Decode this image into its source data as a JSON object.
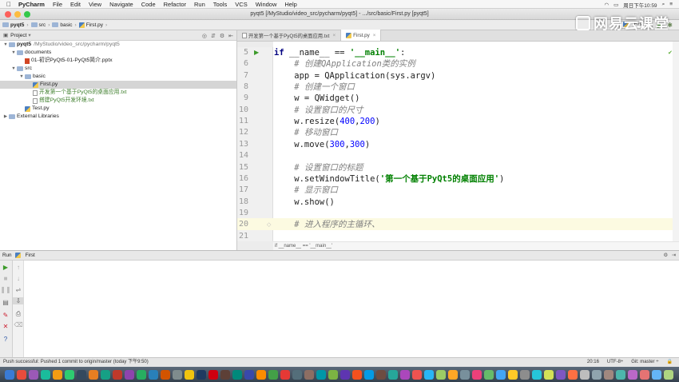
{
  "menubar": {
    "app": "PyCharm",
    "items": [
      "File",
      "Edit",
      "View",
      "Navigate",
      "Code",
      "Refactor",
      "Run",
      "Tools",
      "VCS",
      "Window",
      "Help"
    ],
    "clock": "周日下午10:59"
  },
  "window": {
    "title": "pyqt5 [/MyStudio/video_src/pycharm/pyqt5] - .../src/basic/First.py [pyqt5]"
  },
  "breadcrumbs": [
    "pyqt5",
    "src",
    "basic",
    "First.py"
  ],
  "run_config": "First",
  "watermark": "网易云课堂",
  "project": {
    "header": "Project",
    "tree": [
      {
        "label": "pyqt5",
        "extra": "/MyStudio/video_src/pycharm/pyqt5",
        "depth": 0,
        "arrow": "▼",
        "icon": "folder",
        "style": "bold"
      },
      {
        "label": "documents",
        "extra": "",
        "depth": 1,
        "arrow": "▼",
        "icon": "folder",
        "style": ""
      },
      {
        "label": "01-初识PyQt5-01-PyQt5简介.pptx",
        "extra": "",
        "depth": 2,
        "arrow": "",
        "icon": "ppt",
        "style": ""
      },
      {
        "label": "src",
        "extra": "",
        "depth": 1,
        "arrow": "▼",
        "icon": "folder",
        "style": ""
      },
      {
        "label": "basic",
        "extra": "",
        "depth": 2,
        "arrow": "▼",
        "icon": "folder",
        "style": ""
      },
      {
        "label": "First.py",
        "extra": "",
        "depth": 3,
        "arrow": "",
        "icon": "py",
        "style": "sel"
      },
      {
        "label": "开发第一个基于PyQt5的桌面应用.txt",
        "extra": "",
        "depth": 3,
        "arrow": "",
        "icon": "txt",
        "style": "green"
      },
      {
        "label": "搭建PyQt5开发环境.txt",
        "extra": "",
        "depth": 3,
        "arrow": "",
        "icon": "txt",
        "style": "green"
      },
      {
        "label": "Test.py",
        "extra": "",
        "depth": 2,
        "arrow": "",
        "icon": "py",
        "style": ""
      },
      {
        "label": "External Libraries",
        "extra": "",
        "depth": 0,
        "arrow": "▶",
        "icon": "lib",
        "style": ""
      }
    ]
  },
  "tabs": [
    {
      "label": "开发第一个基于PyQt5的桌面应用.txt",
      "active": false
    },
    {
      "label": "First.py",
      "active": true
    }
  ],
  "editor": {
    "lines": [
      {
        "n": "5",
        "html": [
          [
            "kw",
            "if "
          ],
          [
            "",
            "__name__ == "
          ],
          [
            "str",
            "'__main__'"
          ],
          [
            "",
            ":"
          ]
        ]
      },
      {
        "n": "6",
        "html": [
          [
            "",
            "    "
          ],
          [
            "cm",
            "# 创建QApplication类的实例"
          ]
        ]
      },
      {
        "n": "7",
        "html": [
          [
            "",
            "    app = QApplication(sys.argv)"
          ]
        ]
      },
      {
        "n": "8",
        "html": [
          [
            "",
            "    "
          ],
          [
            "cm",
            "# 创建一个窗口"
          ]
        ]
      },
      {
        "n": "9",
        "html": [
          [
            "",
            "    w = QWidget()"
          ]
        ]
      },
      {
        "n": "10",
        "html": [
          [
            "",
            "    "
          ],
          [
            "cm",
            "# 设置窗口的尺寸"
          ]
        ]
      },
      {
        "n": "11",
        "html": [
          [
            "",
            "    w.resize("
          ],
          [
            "num",
            "400"
          ],
          [
            "",
            ","
          ],
          [
            "num",
            "200"
          ],
          [
            "",
            ")"
          ]
        ]
      },
      {
        "n": "12",
        "html": [
          [
            "",
            "    "
          ],
          [
            "cm",
            "# 移动窗口"
          ]
        ]
      },
      {
        "n": "13",
        "html": [
          [
            "",
            "    w.move("
          ],
          [
            "num",
            "300"
          ],
          [
            "",
            ","
          ],
          [
            "num",
            "300"
          ],
          [
            "",
            ")"
          ]
        ]
      },
      {
        "n": "14",
        "html": [
          [
            "",
            ""
          ]
        ]
      },
      {
        "n": "15",
        "html": [
          [
            "",
            "    "
          ],
          [
            "cm",
            "# 设置窗口的标题"
          ]
        ]
      },
      {
        "n": "16",
        "html": [
          [
            "",
            "    w.setWindowTitle("
          ],
          [
            "str",
            "'第一个基于PyQt5的桌面应用'"
          ],
          [
            "",
            ")"
          ]
        ]
      },
      {
        "n": "17",
        "html": [
          [
            "",
            "    "
          ],
          [
            "cm",
            "# 显示窗口"
          ]
        ]
      },
      {
        "n": "18",
        "html": [
          [
            "",
            "    w.show()"
          ]
        ]
      },
      {
        "n": "19",
        "html": [
          [
            "",
            ""
          ]
        ]
      },
      {
        "n": "20",
        "html": [
          [
            "",
            "    "
          ],
          [
            "cm",
            "# 进入程序的主循环、"
          ]
        ]
      },
      {
        "n": "21",
        "html": [
          [
            "",
            ""
          ]
        ]
      }
    ],
    "status_crumb": "if __name__ == '__main__'"
  },
  "run": {
    "label": "Run",
    "config": "First"
  },
  "status": {
    "message": "Push successful: Pushed 1 commit to origin/master (today 下午9:50)",
    "position": "20:16",
    "encoding": "UTF-8÷",
    "git": "Git: master ÷"
  },
  "colors": {
    "accent": "#2c56a6",
    "keyword": "#000080",
    "string": "#008000",
    "number": "#0000ff",
    "comment": "#808080"
  }
}
